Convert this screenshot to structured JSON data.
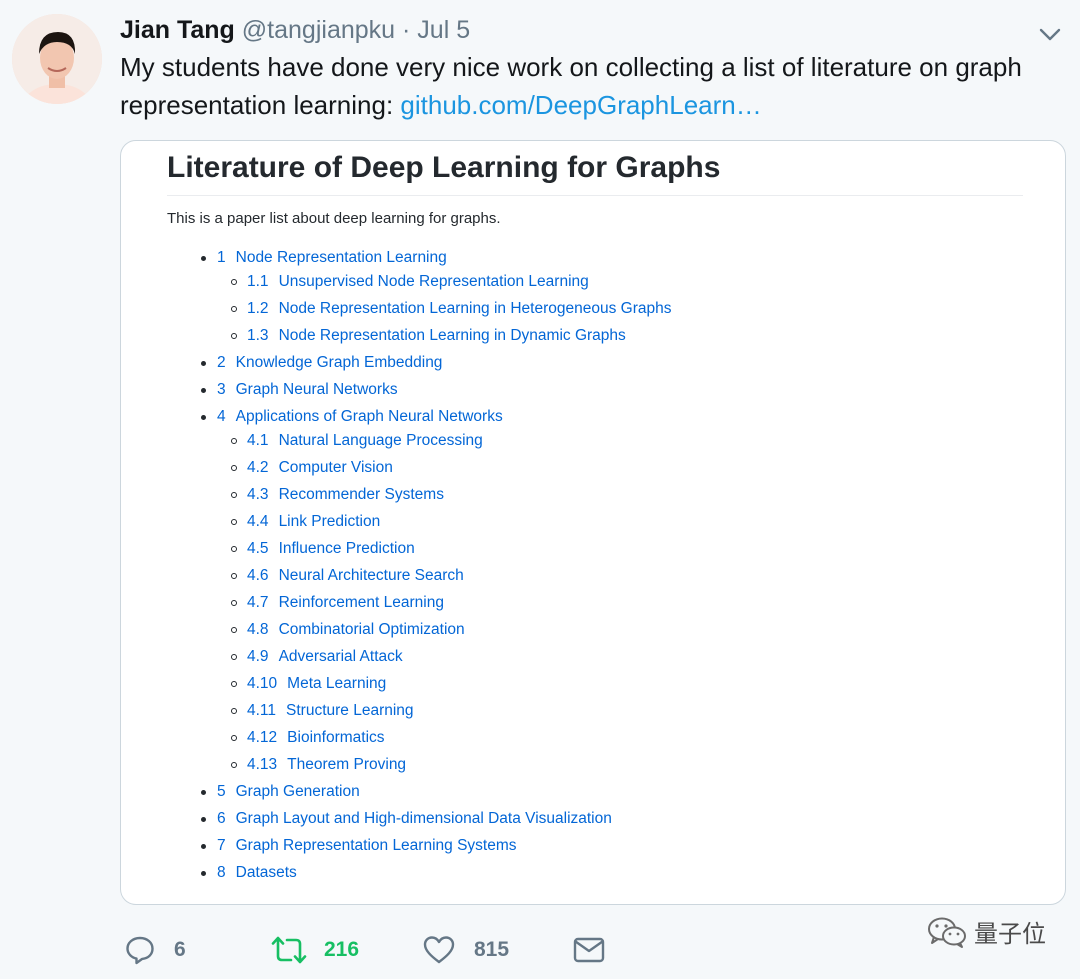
{
  "tweet": {
    "author_name": "Jian Tang",
    "author_handle": "@tangjianpku",
    "separator": "·",
    "date": "Jul 5",
    "text": "My students have done very nice work on collecting a list of literature on graph representation learning: ",
    "link_text": "github.com/DeepGraphLearn…"
  },
  "card": {
    "title": "Literature of Deep Learning for Graphs",
    "intro": "This is a paper list about deep learning for graphs.",
    "toc": [
      {
        "num": "1",
        "label": "Node Representation Learning",
        "level": 1
      },
      {
        "num": "1.1",
        "label": "Unsupervised Node Representation Learning",
        "level": 2
      },
      {
        "num": "1.2",
        "label": "Node Representation Learning in Heterogeneous Graphs",
        "level": 2
      },
      {
        "num": "1.3",
        "label": "Node Representation Learning in Dynamic Graphs",
        "level": 2
      },
      {
        "num": "2",
        "label": "Knowledge Graph Embedding",
        "level": 1
      },
      {
        "num": "3",
        "label": "Graph Neural Networks",
        "level": 1
      },
      {
        "num": "4",
        "label": "Applications of Graph Neural Networks",
        "level": 1
      },
      {
        "num": "4.1",
        "label": "Natural Language Processing",
        "level": 2
      },
      {
        "num": "4.2",
        "label": "Computer Vision",
        "level": 2
      },
      {
        "num": "4.3",
        "label": "Recommender Systems",
        "level": 2
      },
      {
        "num": "4.4",
        "label": "Link Prediction",
        "level": 2
      },
      {
        "num": "4.5",
        "label": "Influence Prediction",
        "level": 2
      },
      {
        "num": "4.6",
        "label": "Neural Architecture Search",
        "level": 2
      },
      {
        "num": "4.7",
        "label": "Reinforcement Learning",
        "level": 2
      },
      {
        "num": "4.8",
        "label": "Combinatorial Optimization",
        "level": 2
      },
      {
        "num": "4.9",
        "label": "Adversarial Attack",
        "level": 2
      },
      {
        "num": "4.10",
        "label": "Meta Learning",
        "level": 2
      },
      {
        "num": "4.11",
        "label": "Structure Learning",
        "level": 2
      },
      {
        "num": "4.12",
        "label": "Bioinformatics",
        "level": 2
      },
      {
        "num": "4.13",
        "label": "Theorem Proving",
        "level": 2
      },
      {
        "num": "5",
        "label": "Graph Generation",
        "level": 1
      },
      {
        "num": "6",
        "label": "Graph Layout and High-dimensional Data Visualization",
        "level": 1
      },
      {
        "num": "7",
        "label": "Graph Representation Learning Systems",
        "level": 1
      },
      {
        "num": "8",
        "label": "Datasets",
        "level": 1
      }
    ]
  },
  "actions": {
    "reply_count": "6",
    "retweet_count": "216",
    "like_count": "815",
    "reply_icon": "speech-bubble-icon",
    "retweet_icon": "retweet-icon",
    "like_icon": "heart-icon",
    "message_icon": "envelope-icon"
  },
  "watermark": {
    "text": "量子位",
    "icon": "wechat-icon"
  },
  "colors": {
    "link": "#1b95e0",
    "toc_link": "#0366d6",
    "retweet_active": "#17bf63",
    "muted": "#657786"
  }
}
